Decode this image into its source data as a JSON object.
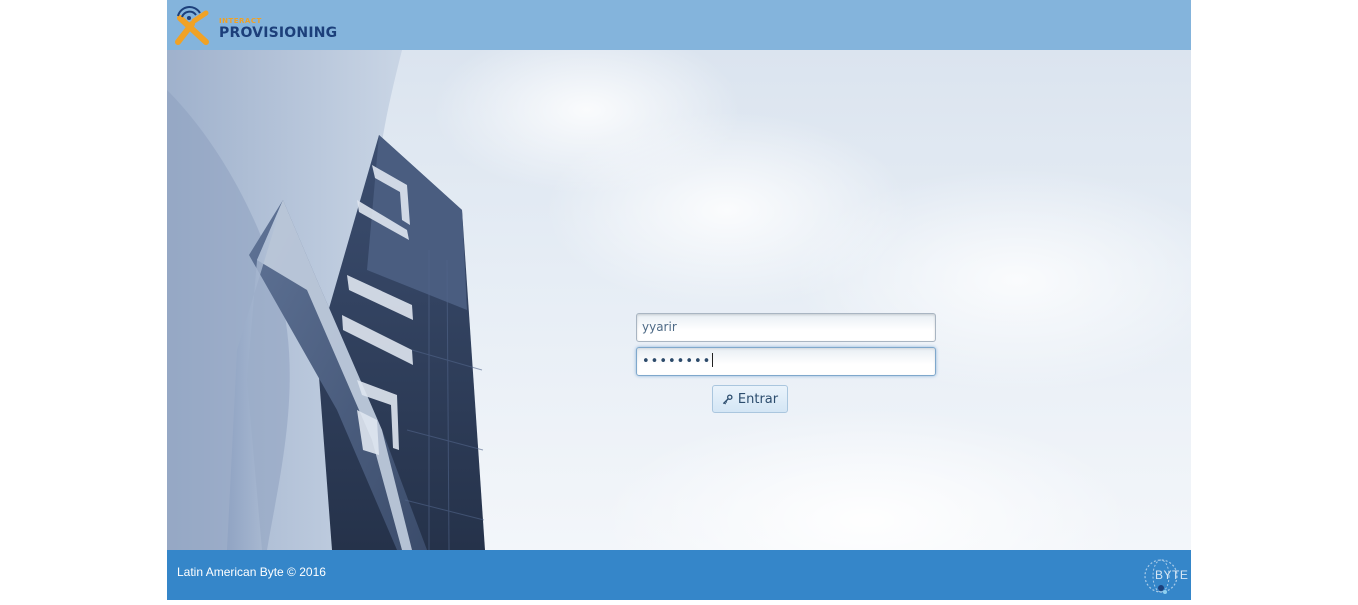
{
  "header": {
    "logo_small": "INTERACT",
    "logo_big": "PROVISIONING"
  },
  "login": {
    "username_value": "yyarir",
    "password_mask": "••••••••",
    "submit_label": "Entrar",
    "submit_icon": "key-icon"
  },
  "footer": {
    "copyright": "Latin American Byte © 2016",
    "logo_text": "BYTE"
  },
  "colors": {
    "header_bg": "#84b4dc",
    "footer_bg": "#3586c9",
    "logo_accent": "#f0a226",
    "logo_text": "#1c3f7a"
  }
}
